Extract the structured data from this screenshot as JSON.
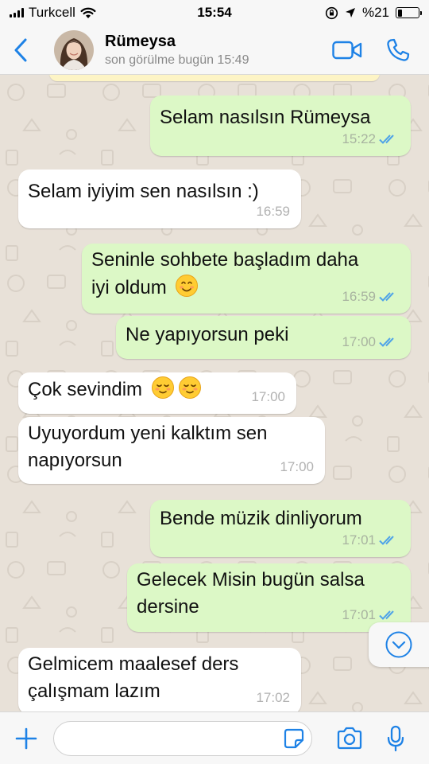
{
  "status_bar": {
    "carrier": "Turkcell",
    "time": "15:54",
    "battery_text": "%21",
    "battery_level": 0.21
  },
  "header": {
    "name": "Rümeysa",
    "status": "son görülme bugün 15:49"
  },
  "colors": {
    "accent": "#1e82e6",
    "outgoing": "#dcf8c6",
    "incoming": "#ffffff",
    "tick": "#4fa3e8"
  },
  "messages": [
    {
      "dir": "out",
      "lines": [
        "Selam nasılsın Rümeysa"
      ],
      "time": "15:22",
      "read": true
    },
    {
      "dir": "in",
      "lines": [
        "Selam iyiyim sen nasılsın :)"
      ],
      "time": "16:59"
    },
    {
      "dir": "out",
      "lines": [
        "Seninle sohbete başladım daha",
        "iyi oldum"
      ],
      "emoji": "smiling-face-emoji",
      "time": "16:59",
      "read": true
    },
    {
      "dir": "out",
      "lines": [
        "Ne yapıyorsun peki"
      ],
      "time": "17:00",
      "read": true
    },
    {
      "dir": "in",
      "lines": [
        "Çok sevindim"
      ],
      "emoji": "relieved-face-emoji x2",
      "time": "17:00"
    },
    {
      "dir": "in",
      "lines": [
        "Uyuyordum yeni kalktım sen",
        "napıyorsun"
      ],
      "time": "17:00"
    },
    {
      "dir": "out",
      "lines": [
        "Bende müzik dinliyorum"
      ],
      "time": "17:01",
      "read": true
    },
    {
      "dir": "out",
      "lines": [
        "Gelecek Misin bugün salsa",
        "dersine"
      ],
      "time": "17:01",
      "read": true
    },
    {
      "dir": "in",
      "lines": [
        "Gelmicem maalesef ders",
        "çalışmam lazım"
      ],
      "time": "17:02"
    }
  ],
  "input": {
    "placeholder": ""
  },
  "icons": [
    "back-chevron-icon",
    "video-call-icon",
    "phone-icon",
    "scroll-down-icon",
    "plus-icon",
    "sticker-icon",
    "camera-icon",
    "mic-icon"
  ]
}
